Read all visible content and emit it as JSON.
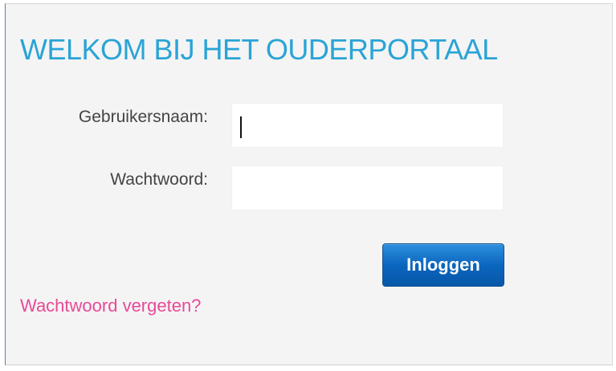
{
  "login": {
    "title": "WELKOM BIJ HET OUDERPORTAAL",
    "username": {
      "label": "Gebruikersnaam:",
      "value": "",
      "placeholder": ""
    },
    "password": {
      "label": "Wachtwoord:",
      "value": "",
      "placeholder": ""
    },
    "submit_label": "Inloggen",
    "forgot_password_label": "Wachtwoord vergeten?"
  },
  "colors": {
    "title": "#2aa4d6",
    "button": "#0a65be",
    "link": "#e84a98",
    "panel_background": "#f4f4f4"
  }
}
